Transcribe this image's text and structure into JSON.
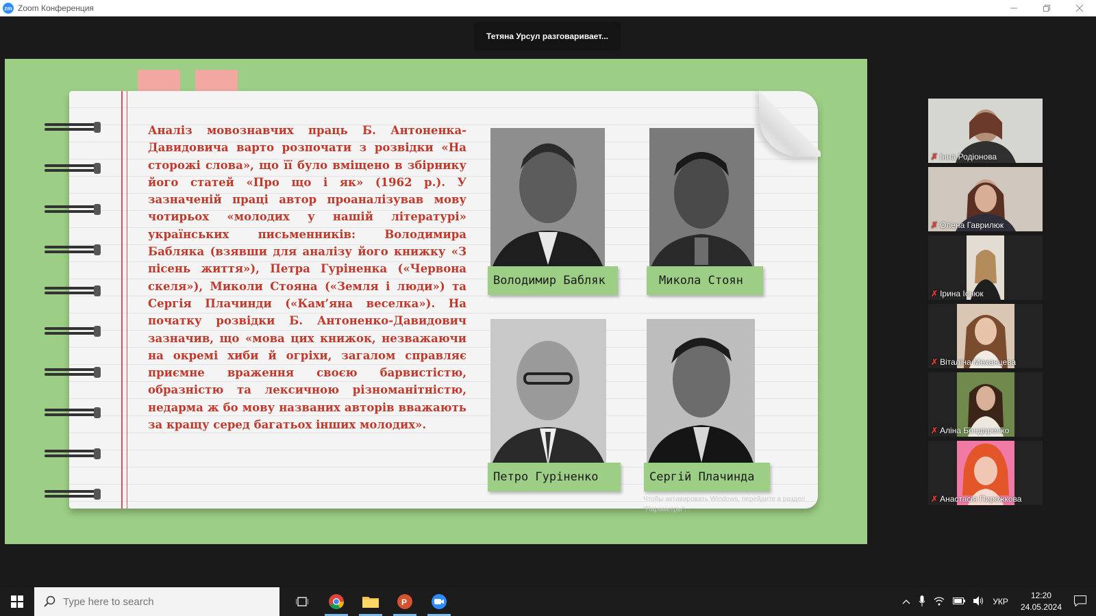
{
  "window": {
    "logo": "zm",
    "title": "Zoom Конференция",
    "minimize_icon": "minimize-icon",
    "restore_icon": "restore-icon",
    "close_icon": "close-icon"
  },
  "speaker_banner": "Тетяна Урсул разговаривает...",
  "slide": {
    "body_text": "Аналіз мовознавчих праць Б. Антоненка-Давидовича варто розпочати з розвідки «На сторожі слова», що її було вміщено в збірнику його статей «Про що і як» (1962 р.). У зазначеній праці автор проаналізував мову чотирьох «молодих у нашій літературі» українських письменників: Володимира Бабляка (взявши для аналізу його книжку «З пісень життя»), Петра Гуріненка («Червона скеля»), Миколи Стояна («Земля і люди») та Сергія Плачинди («Кам’яна веселка»). На початку розвідки Б. Антоненко-Давидович зазначив, що «мова цих книжок, незважаючи на окремі хиби й огріхи, загалом справляє приємне враження своєю барвистістю, образністю та лексичною різноманітністю, недарма ж бо мову названих авторів вважають за кращу серед багатьох інших молодих».",
    "portraits": [
      {
        "caption": "Володимир Бабляк"
      },
      {
        "caption": "Микола Стоян"
      },
      {
        "caption": "Петро Гуріненко"
      },
      {
        "caption": "Сергій Плачинда"
      }
    ],
    "activation_line1": "Чтобы активировать Windows, перейдите в раздел",
    "activation_line2": "\"Параметры\"."
  },
  "participants": [
    {
      "name": "Інна Родіонова"
    },
    {
      "name": "Олена Гаврилюк"
    },
    {
      "name": "Ірина Існюк"
    },
    {
      "name": "Віталіна Механцева"
    },
    {
      "name": "Аліна Бондаренко"
    },
    {
      "name": "Анастасія Пирожкова"
    }
  ],
  "taskbar": {
    "search_placeholder": "Type here to search",
    "language": "УКР",
    "time": "12:20",
    "date": "24.05.2024"
  },
  "colors": {
    "slide_bg": "#9dce85",
    "text_red": "#c0392b",
    "zoom_blue": "#2d8cff"
  }
}
